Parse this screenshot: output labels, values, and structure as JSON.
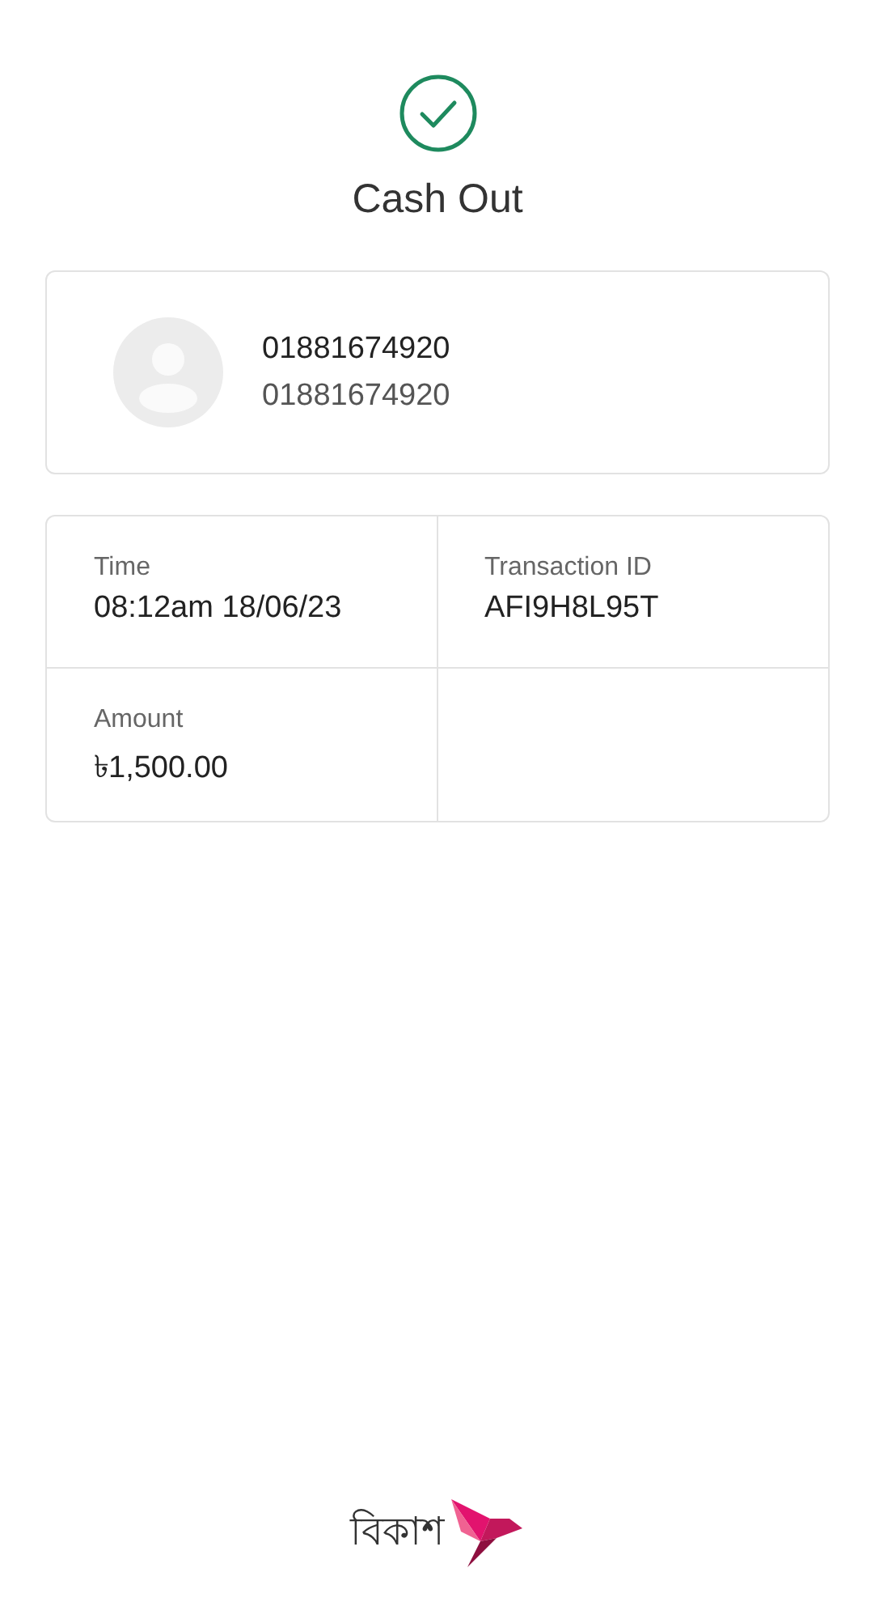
{
  "title": "Cash Out",
  "recipient": {
    "name": "01881674920",
    "number": "01881674920"
  },
  "details": [
    {
      "label": "Time",
      "value": "08:12am 18/06/23"
    },
    {
      "label": "Transaction ID",
      "value": "AFI9H8L95T"
    },
    {
      "label": "Amount",
      "value": "৳1,500.00"
    }
  ],
  "brand": {
    "name": "বিকাশ"
  }
}
